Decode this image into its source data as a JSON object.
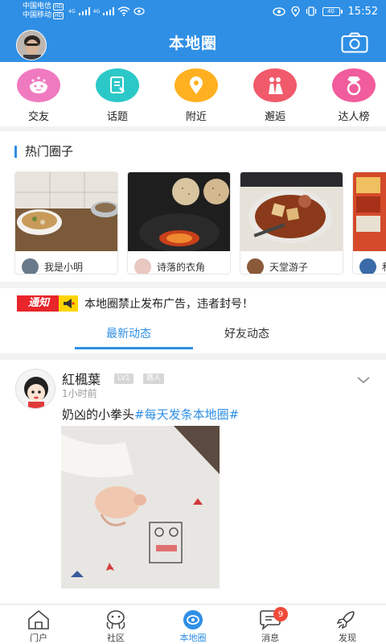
{
  "status_bar": {
    "carrier1": "中国电信",
    "carrier2": "中国移动",
    "hd_tag": "HD",
    "network_tag": "4G",
    "battery": "40",
    "time": "15:52"
  },
  "header": {
    "title": "本地圈"
  },
  "categories": [
    {
      "label": "交友",
      "icon": "face-icon",
      "color": "#f07ac0"
    },
    {
      "label": "话题",
      "icon": "document-icon",
      "color": "#2cc8c8"
    },
    {
      "label": "附近",
      "icon": "location-pin-icon",
      "color": "#ffb020"
    },
    {
      "label": "邂逅",
      "icon": "couple-icon",
      "color": "#f05a6a"
    },
    {
      "label": "达人榜",
      "icon": "diamond-ring-icon",
      "color": "#f05c9c"
    }
  ],
  "hot_circles": {
    "title": "热门圈子",
    "items": [
      {
        "name": "我是小明"
      },
      {
        "name": "诗落的衣角"
      },
      {
        "name": "天堂游子"
      },
      {
        "name": "私"
      }
    ]
  },
  "notice": {
    "tag": "通知",
    "text": "本地圈禁止发布广告，违者封号！"
  },
  "tabs": {
    "latest": "最新动态",
    "friends": "好友动态"
  },
  "post": {
    "author": "紅楓葉",
    "level": "LV1",
    "role": "路人",
    "time": "1小时前",
    "text": "奶凶的小拳头",
    "topic": "#每天发条本地圈#"
  },
  "bottom_nav": [
    {
      "label": "门户",
      "icon": "home-icon"
    },
    {
      "label": "社区",
      "icon": "community-icon"
    },
    {
      "label": "本地圈",
      "icon": "local-circle-icon",
      "active": true
    },
    {
      "label": "消息",
      "icon": "message-icon",
      "badge": "9"
    },
    {
      "label": "发现",
      "icon": "rocket-icon"
    }
  ],
  "colors": {
    "primary": "#2f8fe5",
    "notice_red": "#e8252a",
    "badge_red": "#f04a3a"
  }
}
